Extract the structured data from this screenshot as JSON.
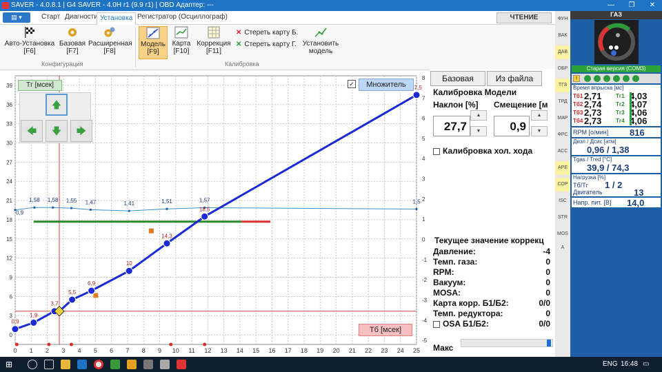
{
  "window": {
    "title": "SAVER - 4.0.8.1  |  G4 SAVER - 4.0H r1 (9.9 r1)  |  OBD Адаптер: ---"
  },
  "menu": {
    "tabs": [
      "Старт",
      "Диагностика",
      "Установка",
      "Регистратор (Осциллограф)"
    ],
    "active": "Установка",
    "read_button": "ЧТЕНИЕ"
  },
  "ribbon": {
    "auto_setup": {
      "label": "Авто-Установка",
      "key": "[F6]"
    },
    "base": {
      "label": "Базовая",
      "key": "[F7]"
    },
    "extended": {
      "label": "Расширенная",
      "key": "[F8]"
    },
    "model": {
      "label": "Модель",
      "key": "[F9]"
    },
    "map": {
      "label": "Карта",
      "key": "[F10]"
    },
    "correction": {
      "label": "Коррекция",
      "key": "[F11]"
    },
    "erase_b": "Стереть карту Б.",
    "erase_g": "Стереть карту Г.",
    "set_model": {
      "l1": "Установить",
      "l2": "модель"
    },
    "group_config": "Конфигурация",
    "group_calib": "Калибровка"
  },
  "chart_labels": {
    "tg": "Тг [мсек]",
    "tb": "Тб [мсек]",
    "multiplier": "Множитель"
  },
  "chart_data": {
    "type": "line",
    "x_ticks": [
      0,
      1,
      2,
      3,
      4,
      5,
      6,
      7,
      8,
      9,
      10,
      11,
      12,
      13,
      14,
      15,
      16,
      17,
      18,
      19,
      20,
      21,
      22,
      23,
      24,
      25
    ],
    "y_ticks": [
      0,
      3,
      6,
      9,
      12,
      15,
      18,
      21,
      24,
      27,
      30,
      33,
      36,
      39
    ],
    "y2_ticks": [
      -5,
      -4,
      -3,
      -2,
      -1,
      0,
      1,
      2,
      3,
      4,
      5,
      6,
      7,
      8
    ],
    "xlim": [
      0,
      25
    ],
    "ylim": [
      -1.5,
      40.5
    ],
    "y2lim": [
      -5.2,
      8.1
    ],
    "series": [
      {
        "name": "Тг [мсек]",
        "x": [
          0,
          1.15,
          2.45,
          2.75,
          3.55,
          4.75,
          7.1,
          9.45,
          11.8,
          25
        ],
        "y": [
          0.9,
          1.9,
          3.7,
          3.7,
          5.5,
          6.9,
          10,
          14.3,
          18.5,
          37.5
        ],
        "labels": [
          "0,9",
          "1,9",
          "3,7",
          "",
          "5,5",
          "6,9",
          "10",
          "14,3",
          "18,5",
          "37,5"
        ]
      },
      {
        "name": "Множитель",
        "x": [
          0,
          1.2,
          2.35,
          3.5,
          4.7,
          7.1,
          9.45,
          11.8,
          25
        ],
        "y": [
          1.46,
          1.58,
          1.58,
          1.55,
          1.47,
          1.41,
          1.51,
          1.57,
          1.5
        ],
        "labels": [
          "",
          "1,58",
          "1,58",
          "1,55",
          "1,47",
          "1,41",
          "1,51",
          "1,57",
          "1,5"
        ]
      }
    ],
    "reference": {
      "x": 2.75,
      "y": 3.7,
      "left_label": "0,9"
    }
  },
  "calib": {
    "base_btn": "Базовая",
    "file_btn": "Из файла",
    "title": "Калибровка Модели",
    "slope_label": "Наклон [%]",
    "offset_label": "Смещение [м",
    "slope": "27,7",
    "offset": "0,9",
    "idle": "Калибровка хол. хода",
    "current_title": "Текущее значение коррекц",
    "rows": [
      {
        "label": "Давление:",
        "value": "-4"
      },
      {
        "label": "Темп. газа:",
        "value": "0"
      },
      {
        "label": "RPM:",
        "value": "0"
      },
      {
        "label": "Вакуум:",
        "value": "0"
      },
      {
        "label": "MOSA:",
        "value": "0"
      },
      {
        "label": "Карта корр. Б1/Б2:",
        "value": "0/0"
      },
      {
        "label": "Темп. редуктора:",
        "value": "0"
      },
      {
        "label": "OSA Б1/Б2:",
        "value": "0/0"
      }
    ],
    "max_label": "Макс"
  },
  "sidetabs": [
    "ФУН",
    "ВАК",
    "ДАВ",
    "ОБР",
    "ТГЗ",
    "ТРД",
    "МАР",
    "ФРС",
    "АСС",
    "АРЕ",
    "СОР",
    "ISC",
    "STR",
    "MOS A"
  ],
  "info": {
    "header": "ГАЗ",
    "version": "Старая версия (COM3)",
    "inj_title": "Время впрыска [мс]",
    "rows": [
      {
        "tb": "Тб1",
        "tbv": "2,71",
        "tg": "Тг1",
        "tgv": "4,03"
      },
      {
        "tb": "Тб2",
        "tbv": "2,74",
        "tg": "Тг2",
        "tgv": "4,07"
      },
      {
        "tb": "Тб3",
        "tbv": "2,73",
        "tg": "Тг3",
        "tgv": "4,06"
      },
      {
        "tb": "Тб4",
        "tbv": "2,73",
        "tg": "Тг4",
        "tgv": "4,06"
      }
    ],
    "rpm_label": "RPM [о/мин]",
    "rpm": "816",
    "press_label": "Дкол / Дсис [атм]",
    "press": "0,96 / 1,38",
    "temp_label": "Tgas / Tred [°C]",
    "temp": "39,9 / 74,3",
    "load_label": "Нагрузка [%]",
    "tbtg_label": "Тб/Тг",
    "tbtg": "1 / 2",
    "engine_label": "Двигатель",
    "engine": "13",
    "volt_label": "Напр. пит. [В]",
    "volt": "14,0"
  },
  "taskbar": {
    "lang": "ENG",
    "time": "16:48"
  }
}
